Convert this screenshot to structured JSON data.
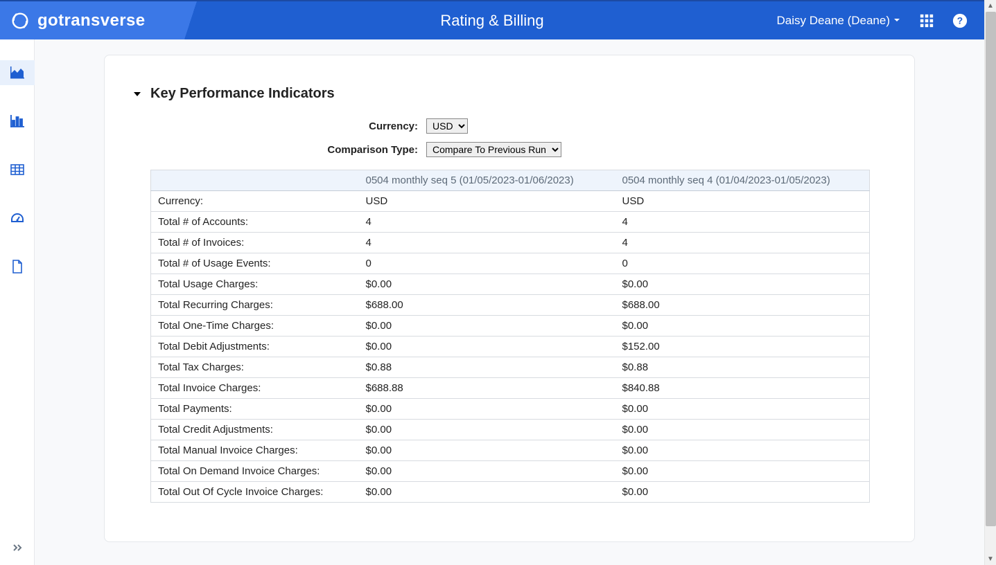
{
  "header": {
    "brand": "gotransverse",
    "title": "Rating & Billing",
    "user": "Daisy Deane (Deane)"
  },
  "section": {
    "title": "Key Performance Indicators"
  },
  "filters": {
    "currency_label": "Currency:",
    "currency_value": "USD",
    "comparison_label": "Comparison Type:",
    "comparison_value": "Compare To Previous Run"
  },
  "table": {
    "cols": [
      "",
      "0504 monthly seq 5 (01/05/2023-01/06/2023)",
      "0504 monthly seq 4 (01/04/2023-01/05/2023)"
    ],
    "rows": [
      {
        "label": "Currency:",
        "a": "USD",
        "b": "USD"
      },
      {
        "label": "Total # of Accounts:",
        "a": "4",
        "b": "4"
      },
      {
        "label": "Total # of Invoices:",
        "a": "4",
        "b": "4"
      },
      {
        "label": "Total # of Usage Events:",
        "a": "0",
        "b": "0"
      },
      {
        "label": "Total Usage Charges:",
        "a": "$0.00",
        "b": "$0.00"
      },
      {
        "label": "Total Recurring Charges:",
        "a": "$688.00",
        "b": "$688.00"
      },
      {
        "label": "Total One-Time Charges:",
        "a": "$0.00",
        "b": "$0.00"
      },
      {
        "label": "Total Debit Adjustments:",
        "a": "$0.00",
        "b": "$152.00"
      },
      {
        "label": "Total Tax Charges:",
        "a": "$0.88",
        "b": "$0.88"
      },
      {
        "label": "Total Invoice Charges:",
        "a": "$688.88",
        "b": "$840.88"
      },
      {
        "label": "Total Payments:",
        "a": "$0.00",
        "b": "$0.00"
      },
      {
        "label": "Total Credit Adjustments:",
        "a": "$0.00",
        "b": "$0.00"
      },
      {
        "label": "Total Manual Invoice Charges:",
        "a": "$0.00",
        "b": "$0.00"
      },
      {
        "label": "Total On Demand Invoice Charges:",
        "a": "$0.00",
        "b": "$0.00"
      },
      {
        "label": "Total Out Of Cycle Invoice Charges:",
        "a": "$0.00",
        "b": "$0.00"
      }
    ]
  }
}
